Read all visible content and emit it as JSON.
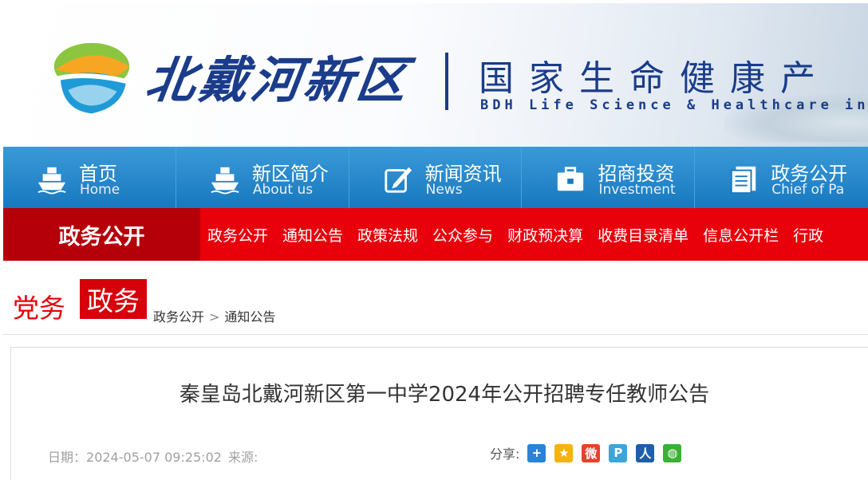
{
  "banner": {
    "calligraphy": "北戴河新区",
    "cn_title": "国家生命健康产",
    "en_title": "BDH Life Science & Healthcare in"
  },
  "nav": {
    "items": [
      {
        "cn": "首页",
        "en": "Home",
        "icon": "ship-icon"
      },
      {
        "cn": "新区简介",
        "en": "About us",
        "icon": "ship-icon"
      },
      {
        "cn": "新闻资讯",
        "en": "News",
        "icon": "edit-icon"
      },
      {
        "cn": "招商投资",
        "en": "Investment",
        "icon": "briefcase-icon"
      },
      {
        "cn": "政务公开",
        "en": "Chief of Pa",
        "icon": "document-icon"
      }
    ]
  },
  "subnav": {
    "section": "政务公开",
    "links": [
      "政务公开",
      "通知公告",
      "政策法规",
      "公众参与",
      "财政预决算",
      "收费目录清单",
      "信息公开栏",
      "行政"
    ]
  },
  "crumbband": {
    "dangwu": "党务",
    "zhengwu": "政务",
    "crumbs": [
      "政务公开",
      "通知公告"
    ],
    "separator": ">"
  },
  "article": {
    "title": "秦皇岛北戴河新区第一中学2024年公开招聘专任教师公告",
    "date_label": "日期：",
    "date": "2024-05-07 09:25:02",
    "source_label": "来源:",
    "share_label": "分享:",
    "share_icons": [
      "plus-icon",
      "qzone-icon",
      "weibo-icon",
      "tencent-weibo-icon",
      "renren-icon",
      "wechat-icon"
    ]
  },
  "colors": {
    "brand_blue": "#1a3c8a",
    "nav_blue": "#1878bf",
    "sub_red": "#e8000b",
    "section_red": "#b5000a"
  }
}
